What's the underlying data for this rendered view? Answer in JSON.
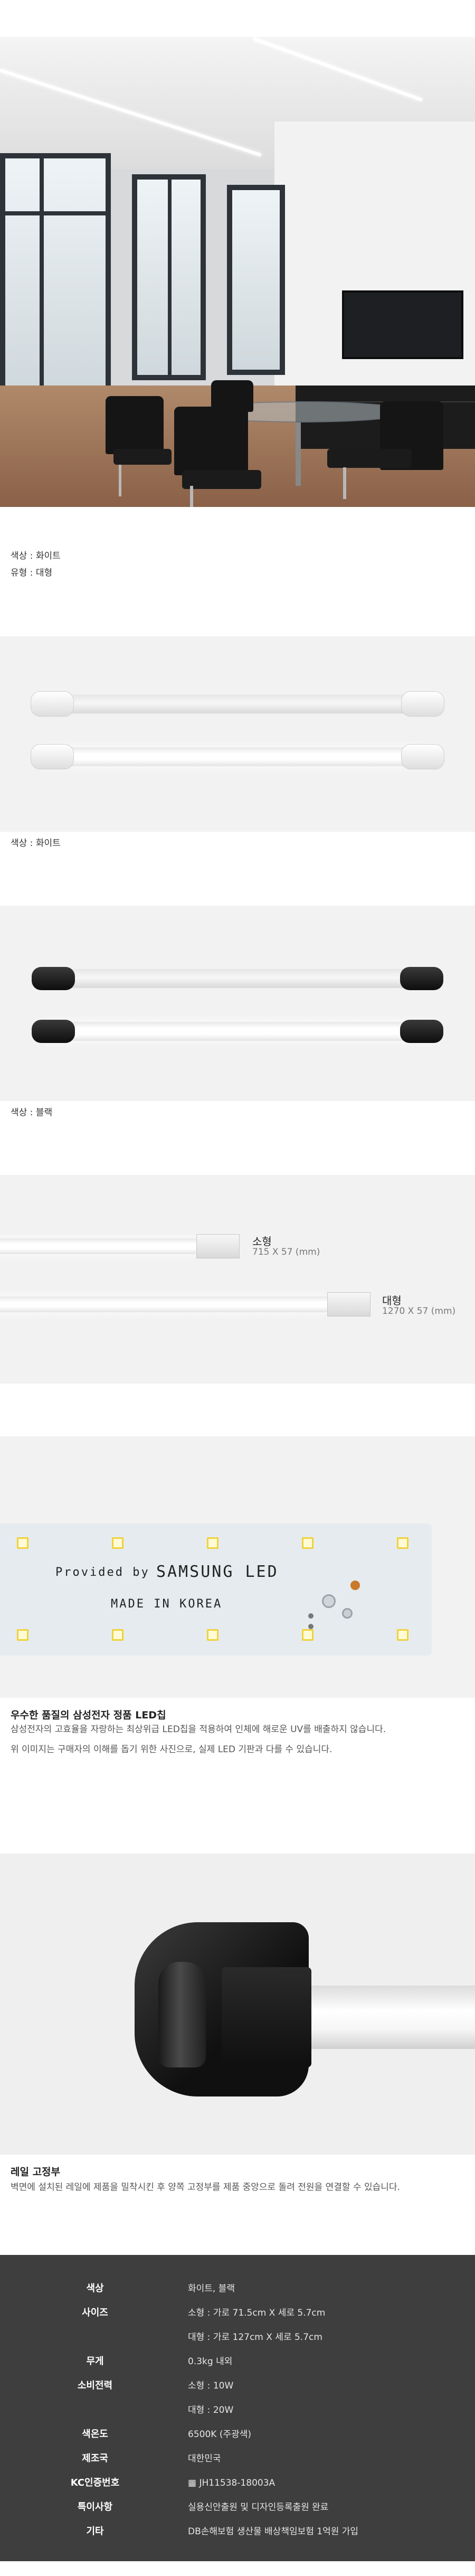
{
  "hero": {
    "caption_color": "색상 : 화이트",
    "caption_type": "유형 : 대형"
  },
  "white_section": {
    "caption": "색상 : 화이트"
  },
  "black_section": {
    "caption": "색상 : 블랙"
  },
  "sizes": {
    "small": {
      "name": "소형",
      "dims": "715 X 57 (mm)"
    },
    "large": {
      "name": "대형",
      "dims": "1270 X 57 (mm)"
    }
  },
  "board": {
    "line1": "Provided by",
    "brand": "SAMSUNG LED",
    "line2": "MADE IN KOREA"
  },
  "chip_section": {
    "heading": "우수한 품질의 삼성전자 정품 LED칩",
    "line1": "삼성전자의 고효율을 자랑하는 최상위급 LED칩을 적용하여 인체에 해로운 UV를 배출하지 않습니다.",
    "line2": "위 이미지는 구매자의 이해를 돕기 위한 사진으로, 실제 LED 기판과 다를 수 있습니다."
  },
  "rail_section": {
    "heading": "레일 고정부",
    "line1": "벽면에 설치된 레일에 제품을 밀착시킨 후 양쪽 고정부를 제품 중앙으로 돌려 전원을 연결할 수 있습니다."
  },
  "spec": {
    "rows": [
      {
        "key": "색상",
        "value": "화이트, 블랙"
      },
      {
        "key": "사이즈",
        "value": "소형 : 가로 71.5cm X 세로 5.7cm"
      },
      {
        "key": "",
        "value": "대형 : 가로 127cm X 세로 5.7cm"
      },
      {
        "key": "무게",
        "value": "0.3kg 내외"
      },
      {
        "key": "소비전력",
        "value": "소형 : 10W"
      },
      {
        "key": "",
        "value": "대형 : 20W"
      },
      {
        "key": "색온도",
        "value": "6500K (주광색)"
      },
      {
        "key": "제조국",
        "value": "대한민국"
      },
      {
        "key": "KC인증번호",
        "value": "JH11538-18003A"
      },
      {
        "key": "특이사항",
        "value": "실용신안출원 및 디자인등록출원 완료"
      },
      {
        "key": "기타",
        "value": "DB손해보험 생산물 배상책임보험 1억원 가입"
      }
    ]
  },
  "colors": {
    "spec_bg": "#3e3e3e",
    "band_bg": "#f2f2f2",
    "chip_yellow": "#f0d23c",
    "board_bg": "#e5ebee"
  }
}
